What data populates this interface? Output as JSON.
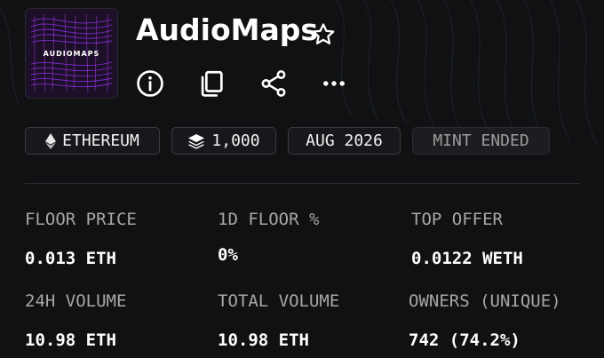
{
  "collection": {
    "name": "AudioMaps",
    "thumbnail_text": "AUDIOMAPS"
  },
  "icons": {
    "favorite": "star-outline-icon",
    "info": "info-icon",
    "copy": "copy-icon",
    "share": "share-icon",
    "more": "more-horizontal-icon"
  },
  "chips": {
    "chain": "ETHEREUM",
    "supply": "1,000",
    "date": "AUG 2026",
    "status": "MINT ENDED"
  },
  "stats": [
    {
      "label": "FLOOR PRICE",
      "value": "0.013 ETH"
    },
    {
      "label": "1D FLOOR %",
      "value": "0%"
    },
    {
      "label": "TOP OFFER",
      "value": "0.0122 WETH"
    },
    {
      "label": "24H VOLUME",
      "value": "10.98 ETH"
    },
    {
      "label": "TOTAL VOLUME",
      "value": "10.98 ETH"
    },
    {
      "label": "OWNERS (UNIQUE)",
      "value": "742 (74.2%)"
    }
  ],
  "colors": {
    "background": "#101113",
    "chip_border": "#3c3c40",
    "label": "#a7a7a7",
    "thumbnail_accent": "#8a2be2"
  }
}
